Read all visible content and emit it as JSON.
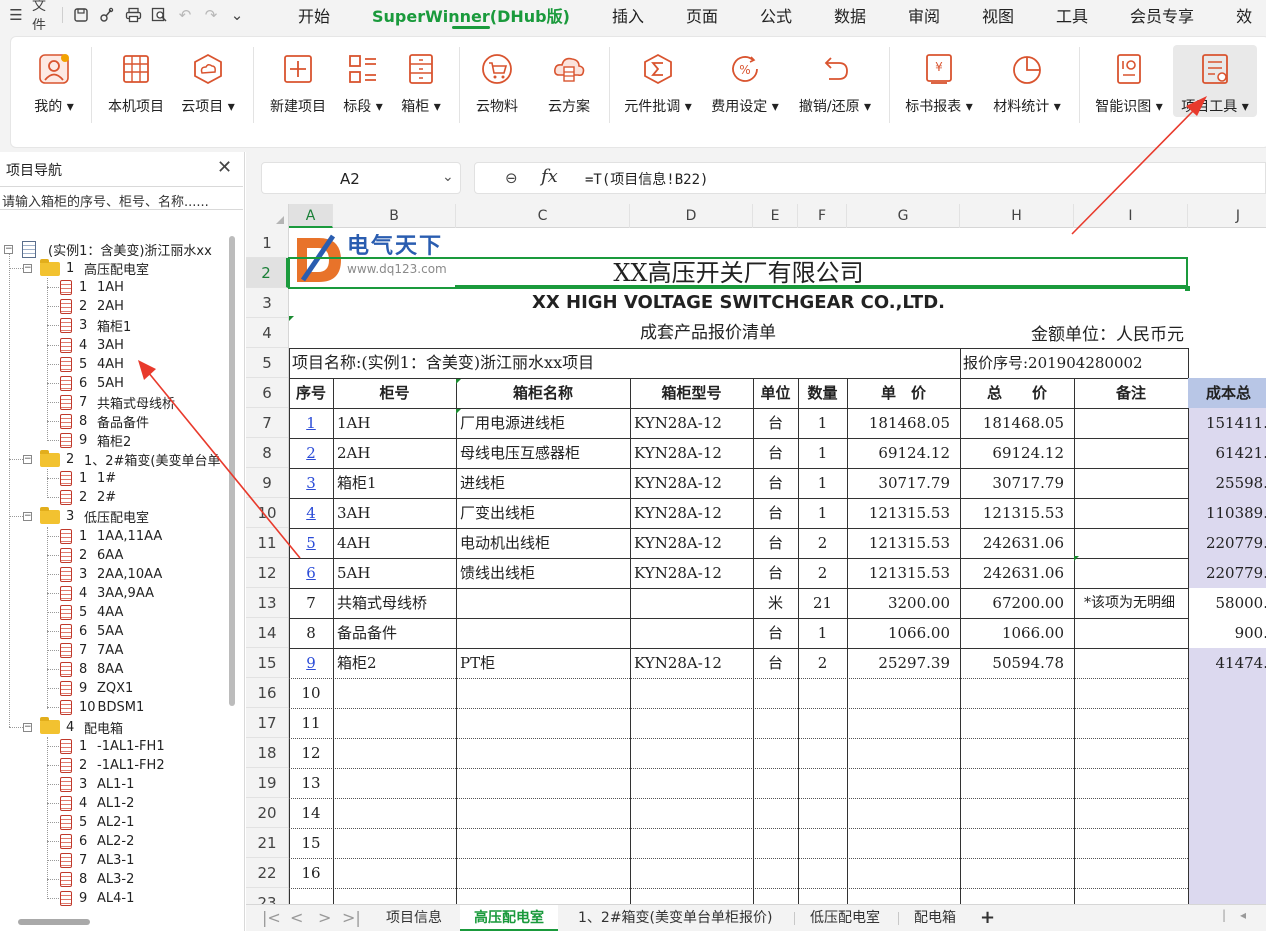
{
  "menubar": {
    "file_label": "文件",
    "tabs": [
      {
        "label": "开始",
        "active": false
      },
      {
        "label": "SuperWinner(DHub版)",
        "active": true
      },
      {
        "label": "插入",
        "active": false
      },
      {
        "label": "页面",
        "active": false
      },
      {
        "label": "公式",
        "active": false
      },
      {
        "label": "数据",
        "active": false
      },
      {
        "label": "审阅",
        "active": false
      },
      {
        "label": "视图",
        "active": false
      },
      {
        "label": "工具",
        "active": false
      },
      {
        "label": "会员专享",
        "active": false
      },
      {
        "label": "效",
        "active": false
      }
    ],
    "accent_color": "#1a9a3c"
  },
  "ribbon": {
    "buttons": [
      {
        "label": "我的",
        "icon": "avatar-icon",
        "dropdown": true
      },
      {
        "label": "本机项目",
        "icon": "local-project-icon",
        "dropdown": false
      },
      {
        "label": "云项目",
        "icon": "cloud-project-icon",
        "dropdown": true
      },
      {
        "label": "新建项目",
        "icon": "new-project-icon",
        "dropdown": false
      },
      {
        "label": "标段",
        "icon": "section-icon",
        "dropdown": true
      },
      {
        "label": "箱柜",
        "icon": "cabinet-icon",
        "dropdown": true
      },
      {
        "label": "云物料",
        "icon": "cloud-material-icon",
        "dropdown": false
      },
      {
        "label": "云方案",
        "icon": "cloud-plan-icon",
        "dropdown": false
      },
      {
        "label": "元件批调",
        "icon": "sigma-icon",
        "dropdown": true
      },
      {
        "label": "费用设定",
        "icon": "percent-icon",
        "dropdown": true
      },
      {
        "label": "撤销/还原",
        "icon": "undo-icon",
        "dropdown": true
      },
      {
        "label": "标书报表",
        "icon": "report-icon",
        "dropdown": true
      },
      {
        "label": "材料统计",
        "icon": "pie-chart-icon",
        "dropdown": true
      },
      {
        "label": "智能识图",
        "icon": "image-recognition-icon",
        "dropdown": true
      },
      {
        "label": "项目工具",
        "icon": "project-tools-icon",
        "dropdown": true
      }
    ]
  },
  "nav": {
    "title": "项目导航",
    "search_placeholder": "请输入箱柜的序号、柜号、名称......",
    "root": "(实例1：含美变)浙江丽水xx",
    "groups": [
      {
        "num": "1",
        "name": "高压配电室",
        "items": [
          {
            "num": "1",
            "name": "1AH"
          },
          {
            "num": "2",
            "name": "2AH"
          },
          {
            "num": "3",
            "name": "箱柜1"
          },
          {
            "num": "4",
            "name": "3AH"
          },
          {
            "num": "5",
            "name": "4AH"
          },
          {
            "num": "6",
            "name": "5AH"
          },
          {
            "num": "7",
            "name": "共箱式母线桥"
          },
          {
            "num": "8",
            "name": "备品备件"
          },
          {
            "num": "9",
            "name": "箱柜2"
          }
        ]
      },
      {
        "num": "2",
        "name": "1、2#箱变(美变单台单",
        "items": [
          {
            "num": "1",
            "name": "1#"
          },
          {
            "num": "2",
            "name": "2#"
          }
        ]
      },
      {
        "num": "3",
        "name": "低压配电室",
        "items": [
          {
            "num": "1",
            "name": "1AA,11AA"
          },
          {
            "num": "2",
            "name": "6AA"
          },
          {
            "num": "3",
            "name": "2AA,10AA"
          },
          {
            "num": "4",
            "name": "3AA,9AA"
          },
          {
            "num": "5",
            "name": "4AA"
          },
          {
            "num": "6",
            "name": "5AA"
          },
          {
            "num": "7",
            "name": "7AA"
          },
          {
            "num": "8",
            "name": "8AA"
          },
          {
            "num": "9",
            "name": "ZQX1"
          },
          {
            "num": "10",
            "name": "BDSM1"
          }
        ]
      },
      {
        "num": "4",
        "name": "配电箱",
        "items": [
          {
            "num": "1",
            "name": "-1AL1-FH1"
          },
          {
            "num": "2",
            "name": "-1AL1-FH2"
          },
          {
            "num": "3",
            "name": "AL1-1"
          },
          {
            "num": "4",
            "name": "AL1-2"
          },
          {
            "num": "5",
            "name": "AL2-1"
          },
          {
            "num": "6",
            "name": "AL2-2"
          },
          {
            "num": "7",
            "name": "AL3-1"
          },
          {
            "num": "8",
            "name": "AL3-2"
          },
          {
            "num": "9",
            "name": "AL4-1"
          }
        ]
      }
    ]
  },
  "formula_bar": {
    "cell_ref": "A2",
    "fx_label": "fx",
    "formula": "=T(项目信息!B22)"
  },
  "grid": {
    "columns": [
      "A",
      "B",
      "C",
      "D",
      "E",
      "F",
      "G",
      "H",
      "I",
      "J"
    ],
    "selected_column": "A",
    "selected_row": "2",
    "rows": [
      "1",
      "2",
      "3",
      "4",
      "5",
      "6",
      "7",
      "8",
      "9",
      "10",
      "11",
      "12",
      "13",
      "14",
      "15",
      "16",
      "17",
      "18",
      "19",
      "20",
      "21",
      "22",
      "23"
    ],
    "logo_brand": "电气天下",
    "logo_url": "www.dq123.com",
    "company_cn": "XX高压开关厂有限公司",
    "company_en": "XX HIGH VOLTAGE SWITCHGEAR CO.,LTD.",
    "doc_title": "成套产品报价清单",
    "currency_unit": "金额单位：人民币元",
    "project_name": "项目名称:(实例1：含美变)浙江丽水xx项目",
    "quote_no": "报价序号:201904280002",
    "headers": [
      "序号",
      "柜号",
      "箱柜名称",
      "箱柜型号",
      "单位",
      "数量",
      "单　价",
      "总　　价",
      "备注",
      "成本总"
    ],
    "items": [
      {
        "no": "1",
        "link": true,
        "cab": "1AH",
        "name": "厂用电源进线柜",
        "model": "KYN28A-12",
        "unit": "台",
        "qty": "1",
        "price": "181468.05",
        "total": "181468.05",
        "note": "",
        "cost": "151411."
      },
      {
        "no": "2",
        "link": true,
        "cab": "2AH",
        "name": "母线电压互感器柜",
        "model": "KYN28A-12",
        "unit": "台",
        "qty": "1",
        "price": "69124.12",
        "total": "69124.12",
        "note": "",
        "cost": "61421."
      },
      {
        "no": "3",
        "link": true,
        "cab": "箱柜1",
        "name": "进线柜",
        "model": "KYN28A-12",
        "unit": "台",
        "qty": "1",
        "price": "30717.79",
        "total": "30717.79",
        "note": "",
        "cost": "25598."
      },
      {
        "no": "4",
        "link": true,
        "cab": "3AH",
        "name": "厂变出线柜",
        "model": "KYN28A-12",
        "unit": "台",
        "qty": "1",
        "price": "121315.53",
        "total": "121315.53",
        "note": "",
        "cost": "110389."
      },
      {
        "no": "5",
        "link": true,
        "cab": "4AH",
        "name": "电动机出线柜",
        "model": "KYN28A-12",
        "unit": "台",
        "qty": "2",
        "price": "121315.53",
        "total": "242631.06",
        "note": "",
        "cost": "220779."
      },
      {
        "no": "6",
        "link": true,
        "cab": "5AH",
        "name": "馈线出线柜",
        "model": "KYN28A-12",
        "unit": "台",
        "qty": "2",
        "price": "121315.53",
        "total": "242631.06",
        "note": "",
        "cost": "220779."
      },
      {
        "no": "7",
        "link": false,
        "cab": "共箱式母线桥",
        "name": "",
        "model": "",
        "unit": "米",
        "qty": "21",
        "price": "3200.00",
        "total": "67200.00",
        "note": "*该项为无明细",
        "cost": "58000."
      },
      {
        "no": "8",
        "link": false,
        "cab": "备品备件",
        "name": "",
        "model": "",
        "unit": "台",
        "qty": "1",
        "price": "1066.00",
        "total": "1066.00",
        "note": "",
        "cost": "900."
      },
      {
        "no": "9",
        "link": true,
        "cab": "箱柜2",
        "name": "PT柜",
        "model": "KYN28A-12",
        "unit": "台",
        "qty": "2",
        "price": "25297.39",
        "total": "50594.78",
        "note": "",
        "cost": "41474."
      }
    ],
    "empty_nos": [
      "10",
      "11",
      "12",
      "13",
      "14",
      "15",
      "16"
    ]
  },
  "sheet_tabs": {
    "tabs": [
      {
        "label": "项目信息",
        "active": false
      },
      {
        "label": "高压配电室",
        "active": true
      },
      {
        "label": "1、2#箱变(美变单台单柜报价)",
        "active": false
      },
      {
        "label": "低压配电室",
        "active": false
      },
      {
        "label": "配电箱",
        "active": false
      }
    ],
    "add_label": "+"
  }
}
